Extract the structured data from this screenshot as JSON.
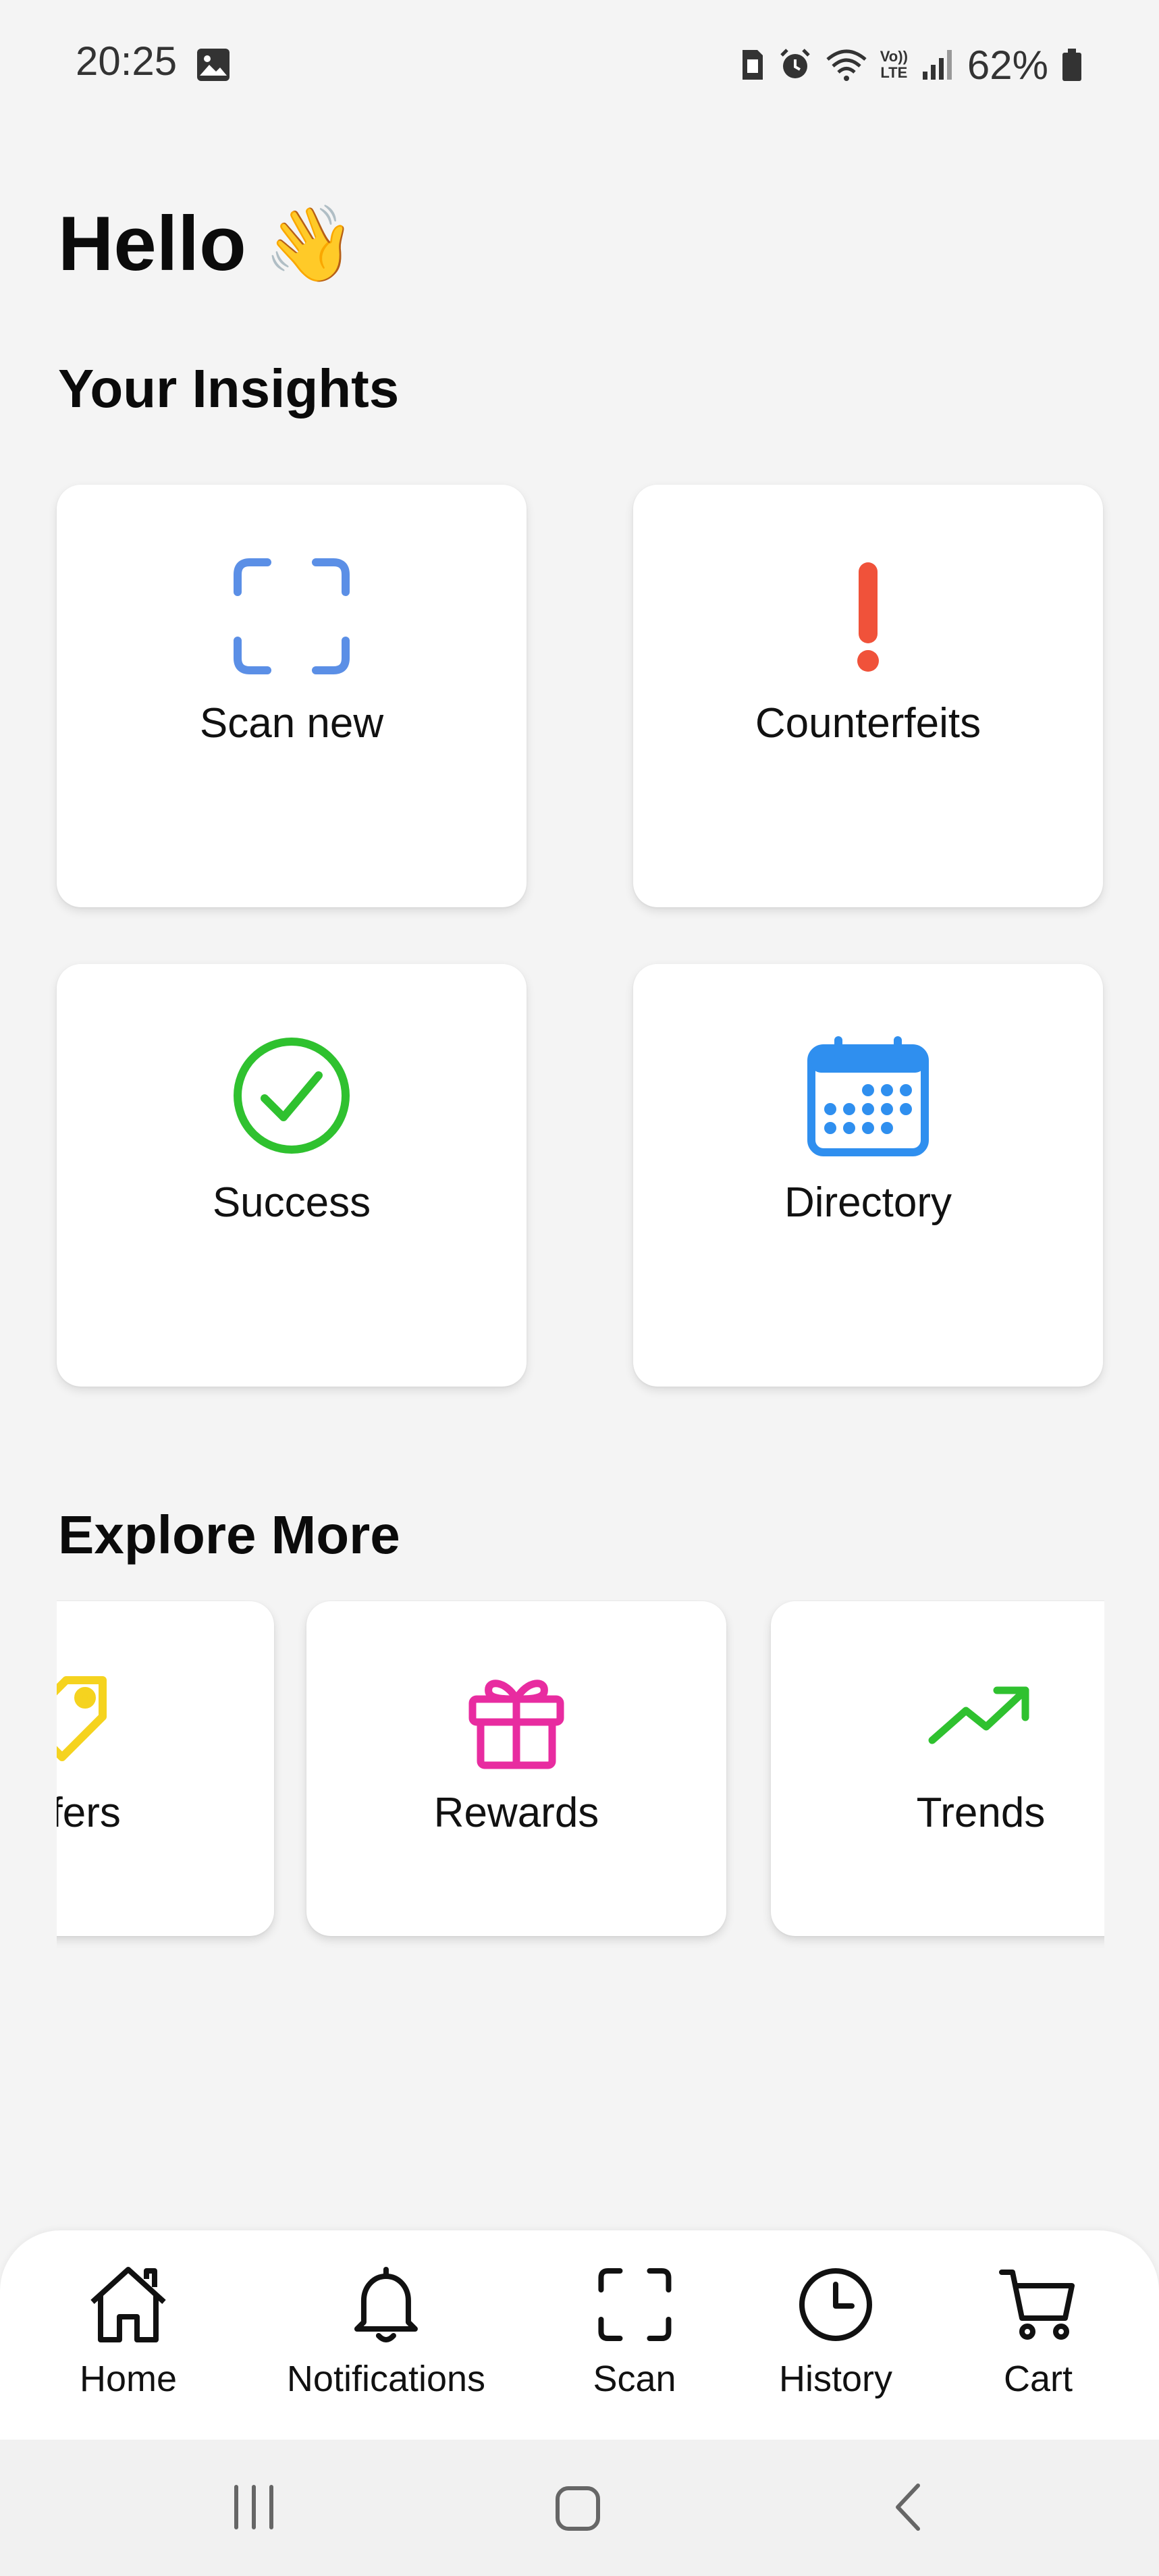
{
  "status_bar": {
    "time": "20:25",
    "battery_percent": "62%",
    "icons": [
      "gallery-icon",
      "sim-icon",
      "alarm-icon",
      "wifi-icon",
      "volte-icon",
      "signal-icon",
      "battery-icon"
    ],
    "volte_label_top": "Vo))",
    "volte_label_bottom": "LTE"
  },
  "greeting": {
    "text": "Hello",
    "emoji": "👋"
  },
  "insights": {
    "title": "Your Insights",
    "cards": [
      {
        "label": "Scan new",
        "icon": "scan-frame-icon",
        "color": "#5b8fe6"
      },
      {
        "label": "Counterfeits",
        "icon": "exclamation-icon",
        "color": "#f0523a"
      },
      {
        "label": "Success",
        "icon": "check-circle-icon",
        "color": "#2fc12f"
      },
      {
        "label": "Directory",
        "icon": "calendar-icon",
        "color": "#2f8fef"
      }
    ]
  },
  "explore": {
    "title": "Explore More",
    "cards": [
      {
        "label": "Offers",
        "icon": "tag-icon",
        "color": "#f5d31f"
      },
      {
        "label": "Rewards",
        "icon": "gift-icon",
        "color": "#e82ca0"
      },
      {
        "label": "Trends",
        "icon": "trending-up-icon",
        "color": "#2fc12f"
      }
    ]
  },
  "bottom_nav": {
    "items": [
      {
        "label": "Home",
        "icon": "home-icon"
      },
      {
        "label": "Notifications",
        "icon": "bell-icon"
      },
      {
        "label": "Scan",
        "icon": "scan-icon"
      },
      {
        "label": "History",
        "icon": "clock-icon"
      },
      {
        "label": "Cart",
        "icon": "cart-icon"
      }
    ]
  },
  "system_nav": {
    "buttons": [
      "recent-apps-icon",
      "home-button-icon",
      "back-icon"
    ]
  }
}
